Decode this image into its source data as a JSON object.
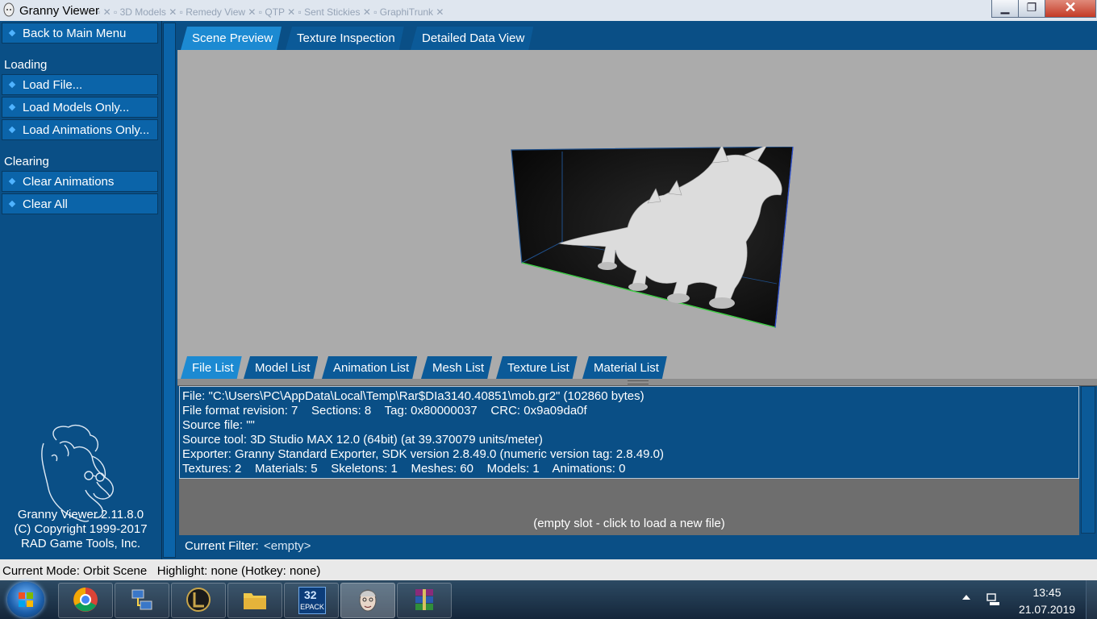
{
  "window": {
    "title": "Granny Viewer"
  },
  "sidebar": {
    "back_label": "Back to Main Menu",
    "loading_header": "Loading",
    "loading_items": [
      "Load File...",
      "Load Models Only...",
      "Load Animations Only..."
    ],
    "clearing_header": "Clearing",
    "clearing_items": [
      "Clear Animations",
      "Clear All"
    ],
    "footer": {
      "version": "Granny Viewer 2.11.8.0",
      "copyright": "(C) Copyright 1999-2017",
      "company": "RAD Game Tools, Inc."
    }
  },
  "top_tabs": [
    "Scene Preview",
    "Texture Inspection",
    "Detailed Data View"
  ],
  "active_top_tab": "Scene Preview",
  "bottom_tabs": [
    "File List",
    "Model List",
    "Animation List",
    "Mesh List",
    "Texture List",
    "Material List"
  ],
  "active_bottom_tab": "File List",
  "file_info": [
    "File: \"C:\\Users\\PC\\AppData\\Local\\Temp\\Rar$DIa3140.40851\\mob.gr2\" (102860 bytes)",
    "File format revision: 7    Sections: 8    Tag: 0x80000037    CRC: 0x9a09da0f",
    "Source file: \"\"",
    "Source tool: 3D Studio MAX 12.0 (64bit) (at 39.370079 units/meter)",
    "Exporter: Granny Standard Exporter, SDK version 2.8.49.0 (numeric version tag: 2.8.49.0)",
    "Textures: 2    Materials: 5    Skeletons: 1    Meshes: 60    Models: 1    Animations: 0"
  ],
  "empty_slot": "(empty slot - click to load a new file)",
  "filter": {
    "label": "Current Filter:",
    "value": "<empty>"
  },
  "status": "Current Mode: Orbit Scene   Highlight: none (Hotkey: none)",
  "taskbar": {
    "apps": [
      "chrome-icon",
      "network-tool-icon",
      "league-icon",
      "file-explorer-icon",
      "epack-icon",
      "granny-viewer-icon",
      "winrar-icon"
    ],
    "epack_text": "EPACK",
    "epack_num": "32",
    "time": "13:45",
    "date": "21.07.2019"
  },
  "colors": {
    "panel": "#0a4f86",
    "button": "#0b64a9",
    "active_tab": "#1c8ad2",
    "viewport": "#ababab"
  }
}
